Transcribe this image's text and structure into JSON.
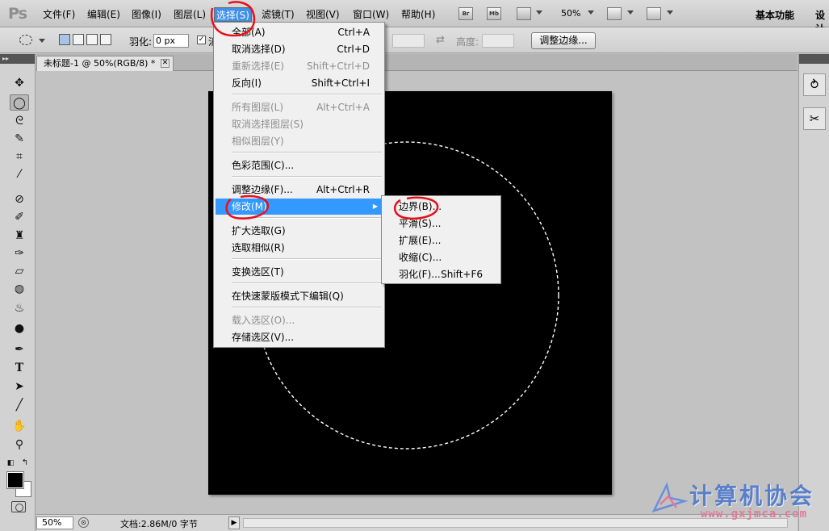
{
  "menubar": {
    "logo": "Ps",
    "items": [
      "文件(F)",
      "编辑(E)",
      "图像(I)",
      "图层(L)",
      "选择(S)",
      "滤镜(T)",
      "视图(V)",
      "窗口(W)",
      "帮助(H)"
    ],
    "active_item": "选择(S)",
    "bridge_label": "Br",
    "minibridge_label": "Mb",
    "zoom": "50%",
    "workspace": "基本功能",
    "workspace_extra": "设计"
  },
  "options": {
    "feather_label": "羽化:",
    "feather_value": "0 px",
    "antialias_checked": true,
    "antialias_label": "消",
    "height_label": "高度:",
    "refine_edge_button": "调整边缘..."
  },
  "document": {
    "tab_title": "未标题-1 @ 50%(RGB/8) *",
    "status_zoom": "50%",
    "status_doc": "文档:2.86M/0 字节"
  },
  "select_menu": {
    "items": [
      {
        "label": "全部(A)",
        "shortcut": "Ctrl+A",
        "disabled": false
      },
      {
        "label": "取消选择(D)",
        "shortcut": "Ctrl+D",
        "disabled": false
      },
      {
        "label": "重新选择(E)",
        "shortcut": "Shift+Ctrl+D",
        "disabled": true
      },
      {
        "label": "反向(I)",
        "shortcut": "Shift+Ctrl+I",
        "disabled": false
      },
      {
        "label": "所有图层(L)",
        "shortcut": "Alt+Ctrl+A",
        "disabled": true
      },
      {
        "label": "取消选择图层(S)",
        "shortcut": "",
        "disabled": true
      },
      {
        "label": "相似图层(Y)",
        "shortcut": "",
        "disabled": true
      },
      {
        "label": "色彩范围(C)...",
        "shortcut": "",
        "disabled": false
      },
      {
        "label": "调整边缘(F)...",
        "shortcut": "Alt+Ctrl+R",
        "disabled": false
      },
      {
        "label": "修改(M)",
        "shortcut": "",
        "disabled": false,
        "submenu": true,
        "highlighted": true
      },
      {
        "label": "扩大选取(G)",
        "shortcut": "",
        "disabled": false
      },
      {
        "label": "选取相似(R)",
        "shortcut": "",
        "disabled": false
      },
      {
        "label": "变换选区(T)",
        "shortcut": "",
        "disabled": false
      },
      {
        "label": "在快速蒙版模式下编辑(Q)",
        "shortcut": "",
        "disabled": false
      },
      {
        "label": "载入选区(O)...",
        "shortcut": "",
        "disabled": true
      },
      {
        "label": "存储选区(V)...",
        "shortcut": "",
        "disabled": false
      }
    ]
  },
  "modify_submenu": {
    "items": [
      {
        "label": "边界(B)...",
        "shortcut": ""
      },
      {
        "label": "平滑(S)...",
        "shortcut": ""
      },
      {
        "label": "扩展(E)...",
        "shortcut": ""
      },
      {
        "label": "收缩(C)...",
        "shortcut": ""
      },
      {
        "label": "羽化(F)...",
        "shortcut": "Shift+F6"
      }
    ]
  },
  "watermark": {
    "title": "计算机协会",
    "url": "www.gxjmca.com"
  },
  "colors": {
    "highlight": "#3399ff",
    "annotation": "#e8101a",
    "canvas": "#000000",
    "foreground": "#000000",
    "background": "#ffffff"
  },
  "tools": [
    "move-icon",
    "ellipse-marquee-icon",
    "lasso-icon",
    "quick-select-icon",
    "crop-icon",
    "eyedropper-icon",
    "healing-brush-icon",
    "brush-icon",
    "clone-stamp-icon",
    "history-brush-icon",
    "eraser-icon",
    "paint-bucket-icon",
    "blur-icon",
    "dodge-icon",
    "pen-icon",
    "type-icon",
    "path-select-icon",
    "line-icon",
    "hand-icon",
    "zoom-icon"
  ]
}
